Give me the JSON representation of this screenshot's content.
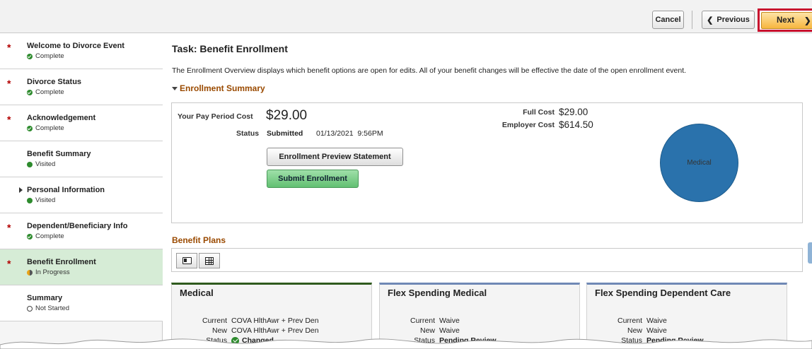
{
  "toolbar": {
    "cancel_label": "Cancel",
    "previous_label": "Previous",
    "next_label": "Next"
  },
  "sidebar": {
    "items": [
      {
        "label": "Welcome to Divorce Event",
        "status": "Complete",
        "required": true
      },
      {
        "label": "Divorce Status",
        "status": "Complete",
        "required": true
      },
      {
        "label": "Acknowledgement",
        "status": "Complete",
        "required": true
      },
      {
        "label": "Benefit Summary",
        "status": "Visited",
        "required": false
      },
      {
        "label": "Personal Information",
        "status": "Visited",
        "required": false
      },
      {
        "label": "Dependent/Beneficiary Info",
        "status": "Complete",
        "required": true
      },
      {
        "label": "Benefit Enrollment",
        "status": "In Progress",
        "required": true
      },
      {
        "label": "Summary",
        "status": "Not Started",
        "required": false
      }
    ]
  },
  "main": {
    "task_title": "Task: Benefit Enrollment",
    "overview_text": "The Enrollment Overview displays which benefit options are open for edits. All of your benefit changes will be effective the date of the open enrollment event.",
    "enrollment_summary_heading": "Enrollment Summary",
    "pay_period_cost_label": "Your Pay Period Cost",
    "pay_period_cost_value": "$29.00",
    "status_label": "Status",
    "status_value": "Submitted",
    "status_datetime": "01/13/2021  9:56PM",
    "full_cost_label": "Full Cost",
    "full_cost_value": "$29.00",
    "employer_cost_label": "Employer Cost",
    "employer_cost_value": "$614.50",
    "preview_button": "Enrollment Preview Statement",
    "submit_button": "Submit Enrollment",
    "pie_label": "Medical",
    "benefit_plans_heading": "Benefit Plans",
    "plans": [
      {
        "title": "Medical",
        "current_label": "Current",
        "current": "COVA HlthAwr + Prev Den",
        "new_label": "New",
        "new": "COVA HlthAwr + Prev Den",
        "status_label": "Status",
        "status": "Changed"
      },
      {
        "title": "Flex Spending Medical",
        "current_label": "Current",
        "current": "Waive",
        "new_label": "New",
        "new": "Waive",
        "status_label": "Status",
        "status": "Pending Review"
      },
      {
        "title": "Flex Spending Dependent Care",
        "current_label": "Current",
        "current": "Waive",
        "new_label": "New",
        "new": "Waive",
        "status_label": "Status",
        "status": "Pending Review"
      }
    ]
  },
  "colors": {
    "accent_heading": "#9a4a00",
    "next_button": "#f7b63f",
    "highlight_border": "#c8102e",
    "submit_button": "#62c072",
    "pie_fill": "#2a72ac",
    "active_step": "#d6ecd6"
  }
}
